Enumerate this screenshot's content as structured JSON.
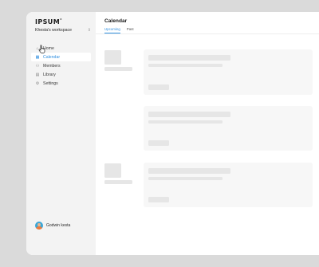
{
  "brand": {
    "logo_text": "IPSUM",
    "workspace_name": "Khesta's workspace"
  },
  "nav": [
    {
      "label": "Home",
      "icon": "home-icon",
      "active": false
    },
    {
      "label": "Calendar",
      "icon": "calendar-icon",
      "active": true
    },
    {
      "label": "Members",
      "icon": "members-icon",
      "active": false
    },
    {
      "label": "Library",
      "icon": "library-icon",
      "active": false
    },
    {
      "label": "Settings",
      "icon": "settings-icon",
      "active": false
    }
  ],
  "user": {
    "name": "Godwin kesta"
  },
  "main": {
    "title": "Calendar",
    "tabs": [
      {
        "label": "Upcoming",
        "active": true
      },
      {
        "label": "Past",
        "active": false
      }
    ]
  },
  "colors": {
    "accent": "#2f8fe0",
    "sidebar_bg": "#f3f3f3",
    "page_bg": "#dadada",
    "skeleton": "#e6e6e6"
  }
}
